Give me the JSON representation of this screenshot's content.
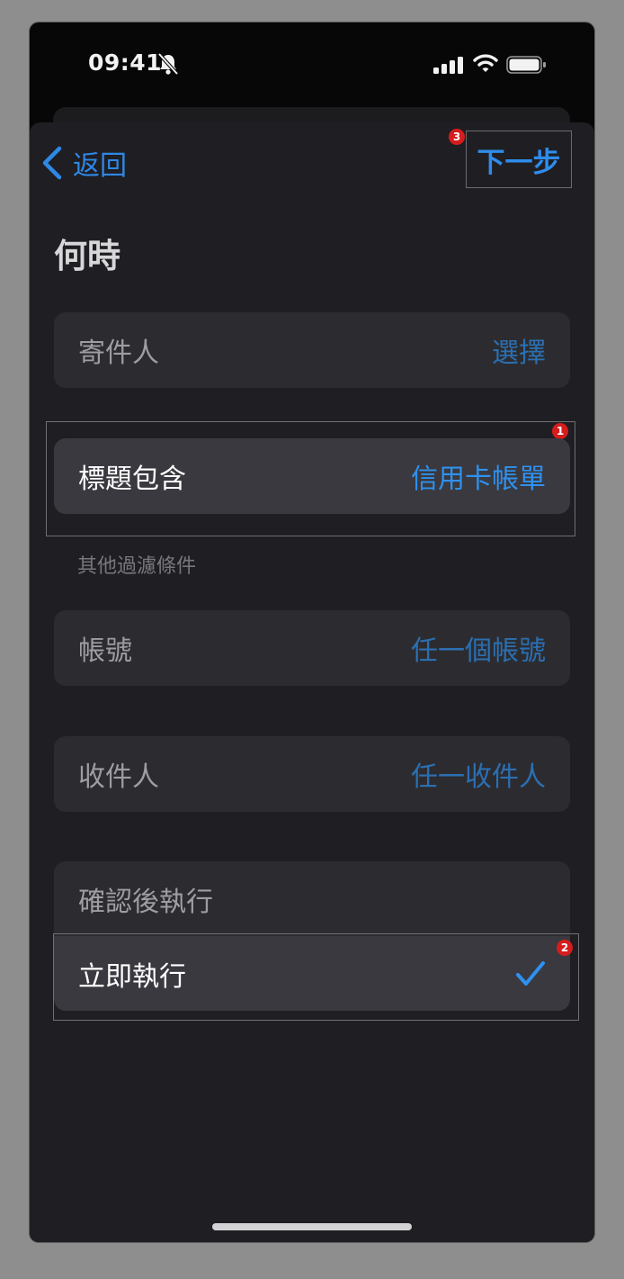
{
  "status_bar": {
    "time": "09:41"
  },
  "nav": {
    "back_label": "返回",
    "next_label": "下一步"
  },
  "badges": {
    "b1": "1",
    "b2": "2",
    "b3": "3"
  },
  "section": {
    "title": "何時",
    "other_filters": "其他過濾條件"
  },
  "rows": {
    "sender": {
      "label": "寄件人",
      "value": "選擇"
    },
    "subject": {
      "label": "標題包含",
      "value": "信用卡帳單"
    },
    "account": {
      "label": "帳號",
      "value": "任一個帳號"
    },
    "recipient": {
      "label": "收件人",
      "value": "任一收件人"
    }
  },
  "run_options": {
    "confirm": {
      "label": "確認後執行"
    },
    "immediate": {
      "label": "立即執行",
      "selected": true
    }
  },
  "colors": {
    "accent": "#2e91ef",
    "background": "#1f1e23",
    "badge": "#d51d1d"
  }
}
